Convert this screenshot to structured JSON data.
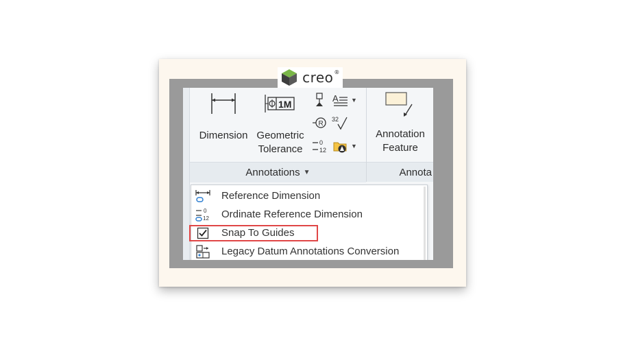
{
  "logo": {
    "text": "creo",
    "tm": "®"
  },
  "ribbon": {
    "dimension_label": "Dimension",
    "geometric_tolerance_line1": "Geometric",
    "geometric_tolerance_line2": "Tolerance",
    "gtol_icon_text": "1M",
    "annotation_feature_line1": "Annotation",
    "annotation_feature_line2": "Feature",
    "annotations_group_label": "Annotations",
    "annota_group_label": "Annota",
    "ordinate_small_text_top": "0",
    "ordinate_small_text_bottom": "12",
    "finish_small_text": "32"
  },
  "menu": {
    "items": [
      {
        "label": "Reference Dimension",
        "icon": "reference-dimension-icon"
      },
      {
        "label": "Ordinate Reference Dimension",
        "icon": "ordinate-reference-dimension-icon"
      },
      {
        "label": "Snap To Guides",
        "icon": "checkbox-checked-icon",
        "checked": true
      },
      {
        "label": "Legacy Datum Annotations Conversion",
        "icon": "legacy-datum-conversion-icon"
      }
    ]
  },
  "colors": {
    "highlight": "#e04646",
    "accent_blue": "#2f7fd1",
    "frame_gray": "#9a9a9a",
    "card_bg": "#fdf7ee"
  }
}
